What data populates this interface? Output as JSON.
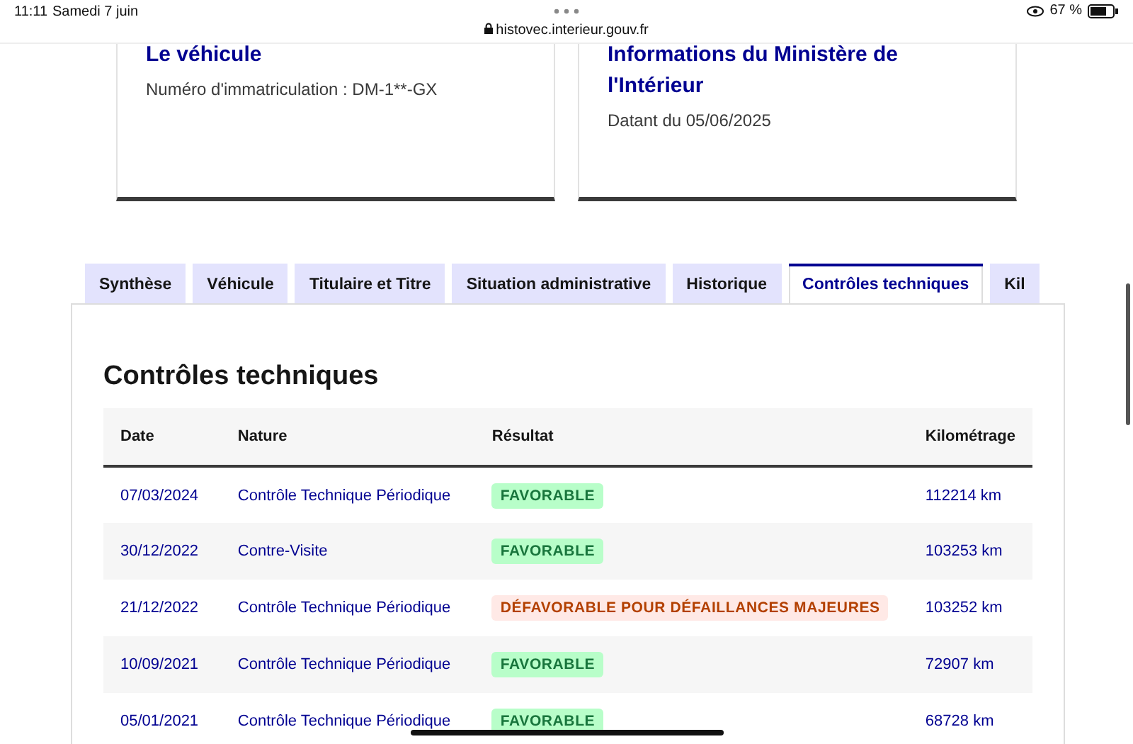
{
  "status_bar": {
    "time": "11:11",
    "date": "Samedi 7 juin",
    "url": "histovec.interieur.gouv.fr",
    "battery": "67 %"
  },
  "cards": [
    {
      "title": "Le véhicule",
      "text": "Numéro d'immatriculation : DM-1**-GX"
    },
    {
      "title": "Informations du Ministère de l'Intérieur",
      "text": "Datant du 05/06/2025"
    }
  ],
  "tabs": [
    {
      "label": "Synthèse",
      "selected": false
    },
    {
      "label": "Véhicule",
      "selected": false
    },
    {
      "label": "Titulaire et Titre",
      "selected": false
    },
    {
      "label": "Situation administrative",
      "selected": false
    },
    {
      "label": "Historique",
      "selected": false
    },
    {
      "label": "Contrôles techniques",
      "selected": true
    },
    {
      "label": "Kil",
      "selected": false
    }
  ],
  "section_title": "Contrôles techniques",
  "table": {
    "columns": [
      "Date",
      "Nature",
      "Résultat",
      "Kilométrage"
    ],
    "rows": [
      {
        "date": "07/03/2024",
        "nature": "Contrôle Technique Périodique",
        "result": {
          "label": "FAVORABLE",
          "kind": "success"
        },
        "mileage": "112214 km"
      },
      {
        "date": "30/12/2022",
        "nature": "Contre-Visite",
        "result": {
          "label": "FAVORABLE",
          "kind": "success"
        },
        "mileage": "103253 km"
      },
      {
        "date": "21/12/2022",
        "nature": "Contrôle Technique Périodique",
        "result": {
          "label": "DÉFAVORABLE POUR DÉFAILLANCES MAJEURES",
          "kind": "error"
        },
        "mileage": "103252 km"
      },
      {
        "date": "10/09/2021",
        "nature": "Contrôle Technique Périodique",
        "result": {
          "label": "FAVORABLE",
          "kind": "success"
        },
        "mileage": "72907 km"
      },
      {
        "date": "05/01/2021",
        "nature": "Contrôle Technique Périodique",
        "result": {
          "label": "FAVORABLE",
          "kind": "success"
        },
        "mileage": "68728 km"
      }
    ]
  }
}
